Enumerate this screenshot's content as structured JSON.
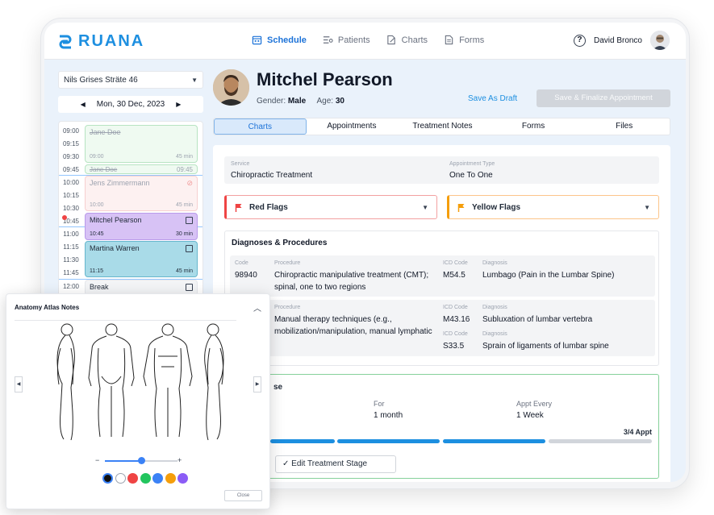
{
  "brand": {
    "name": "RUANA",
    "accent": "#1d8fe0"
  },
  "nav": [
    {
      "label": "Schedule",
      "icon": "calendar-icon",
      "active": true
    },
    {
      "label": "Patients",
      "icon": "patients-icon",
      "active": false
    },
    {
      "label": "Charts",
      "icon": "charts-icon",
      "active": false
    },
    {
      "label": "Forms",
      "icon": "forms-icon",
      "active": false
    }
  ],
  "user": {
    "name": "David Bronco",
    "help": "?"
  },
  "schedule": {
    "clinic": "Nils Grises Sträte 46",
    "date": "Mon, 30 Dec, 2023",
    "times": [
      "09:00",
      "09:15",
      "09:30",
      "09:45",
      "10:00",
      "10:15",
      "10:30",
      "10:45",
      "11:00",
      "11:15",
      "11:30",
      "11:45",
      "12:00"
    ],
    "appointments": [
      {
        "name": "Jane Doe",
        "start": "09:00",
        "duration": "45 min"
      },
      {
        "name": "Jane Doe",
        "start": "09:45"
      },
      {
        "name": "Jens Zimmermann",
        "start": "10:00",
        "duration": "45 min"
      },
      {
        "name": "Mitchel Pearson",
        "start": "10:45",
        "duration": "30 min"
      },
      {
        "name": "Martina Warren",
        "start": "11:15",
        "duration": "45 min"
      },
      {
        "name": "Break"
      }
    ]
  },
  "patient": {
    "name": "Mitchel Pearson",
    "gender_label": "Gender:",
    "gender": "Male",
    "age_label": "Age:",
    "age": "30"
  },
  "actions": {
    "save_draft": "Save As Draft",
    "finalize": "Save & Finalize Appointment"
  },
  "tabs": [
    "Charts",
    "Appointments",
    "Treatment Notes",
    "Forms",
    "Files"
  ],
  "service": {
    "service_label": "Service",
    "service_value": "Chiropractic Treatment",
    "type_label": "Appointment Type",
    "type_value": "One To One"
  },
  "flags": {
    "red": "Red Flags",
    "yellow": "Yellow Flags"
  },
  "diagnoses": {
    "title": "Diagnoses & Procedures",
    "headers": {
      "code": "Code",
      "procedure": "Procedure",
      "icd": "ICD Code",
      "diagnosis": "Diagnosis"
    },
    "row1": {
      "code": "98940",
      "procedure_line1": "Chiropractic manipulative treatment (CMT);",
      "procedure_line2": "spinal, one to two regions",
      "icd": "M54.5",
      "diagnosis": "Lumbago (Pain in the Lumbar Spine)"
    },
    "row2": {
      "procedure_line1": "Manual therapy techniques (e.g.,",
      "procedure_line2": "mobilization/manipulation, manual lymphatic",
      "icd1": "M43.16",
      "diagnosis1": "Subluxation of lumbar vertebra",
      "icd2": "S33.5",
      "diagnosis2": "Sprain of ligaments of lumbar spine"
    }
  },
  "plan": {
    "title_fragment": "se",
    "for_label": "For",
    "for_value": "1 month",
    "every_label": "Appt Every",
    "every_value": "1 Week",
    "progress_text": "3/4 Appt",
    "progress_completed": 3,
    "progress_total": 4,
    "edit_label": "Edit Treatment Stage"
  },
  "atlas": {
    "title": "Anatomy Atlas Notes",
    "slider_minus": "−",
    "slider_plus": "+",
    "slider_value": 0.5,
    "colors": [
      "#111111",
      "#ffffff",
      "#ef4444",
      "#22c55e",
      "#3b82f6",
      "#f59e0b",
      "#8b5cf6"
    ],
    "close_label": "Close"
  }
}
